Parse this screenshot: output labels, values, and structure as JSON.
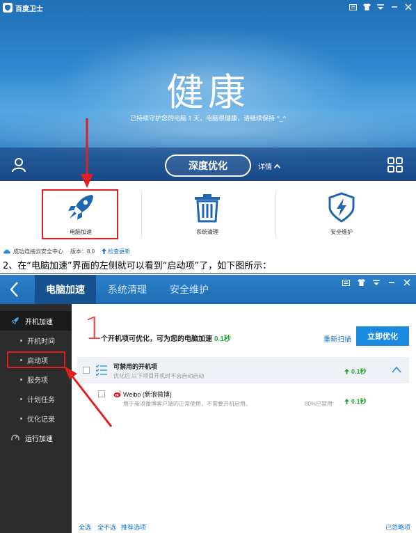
{
  "top": {
    "app_title": "百度卫士",
    "hero_title": "健康",
    "hero_subtitle": "已持续守护您的电脑 1 天，电脑很健康，请继续保持 ^_^",
    "optimize_button": "深度优化",
    "detail_link": "详情",
    "features": [
      {
        "label": "电脑加速",
        "icon": "rocket-icon"
      },
      {
        "label": "系统清理",
        "icon": "trash-icon"
      },
      {
        "label": "安全维护",
        "icon": "shield-bolt-icon"
      }
    ],
    "status": {
      "connected": "成功连接云安全中心",
      "version": "版本：8.0",
      "check_update": "检查更新"
    },
    "colors": {
      "hero_blue": "#2f89d1",
      "highlight_red": "#e02020"
    }
  },
  "caption": "2、在“电脑加速”界面的左侧就可以看到“启动项”了，如下图所示：",
  "bottom": {
    "tabs": [
      "电脑加速",
      "系统清理",
      "安全维护"
    ],
    "active_tab": "电脑加速",
    "sidebar": [
      {
        "label": "开机加速",
        "type": "main",
        "icon": "rocket-icon"
      },
      {
        "label": "开机时间",
        "type": "sub"
      },
      {
        "label": "启动项",
        "type": "sub"
      },
      {
        "label": "服务项",
        "type": "sub"
      },
      {
        "label": "计划任务",
        "type": "sub"
      },
      {
        "label": "优化记录",
        "type": "sub"
      },
      {
        "label": "运行加速",
        "type": "main",
        "icon": "speedometer-icon"
      }
    ],
    "big_count": "1",
    "summary_text": "个开机项可优化，可为您的电脑加速",
    "summary_gain": "0.1秒",
    "rescan": "重新扫描",
    "optimize_now": "立即优化",
    "group": {
      "title": "可禁用的开机项",
      "desc": "优化后,以下项目开机时不会自动启动",
      "gain": "0.1秒"
    },
    "item": {
      "name": "Weibo (新浪微博)",
      "desc": "用于新浪微博客户端的正常使用，不需要开机启用。",
      "pct": "80%已禁用",
      "gain": "0.1秒"
    },
    "footer": {
      "select_all": "全选",
      "select_none": "全不选",
      "recommended": "推荐选项",
      "ignored": "已忽略项"
    },
    "colors": {
      "header_blue": "#1f6db5",
      "sidebar_dark": "#2c2c2c",
      "gain_green": "#2aa63a",
      "link_blue": "#1a73c9"
    }
  }
}
